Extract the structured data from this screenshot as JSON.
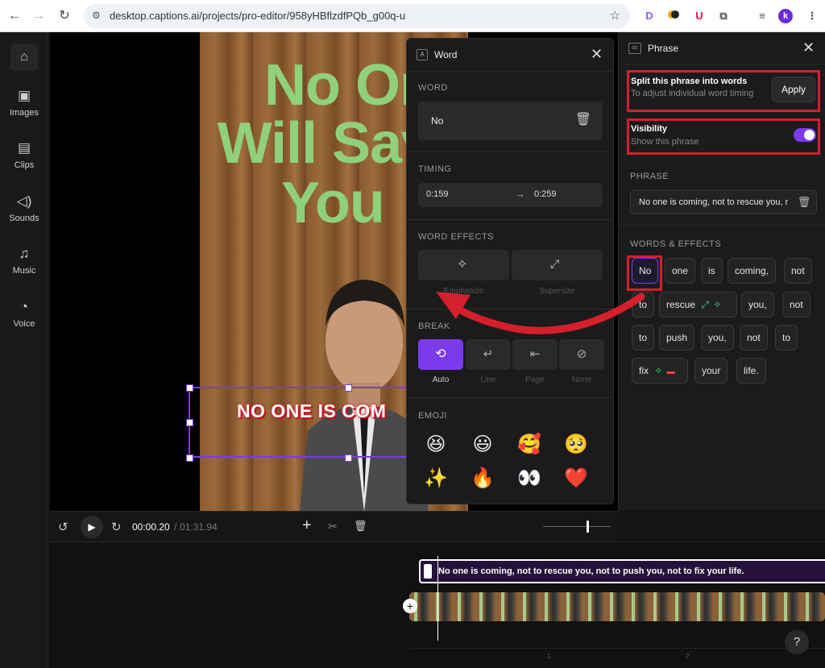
{
  "browser": {
    "url": "desktop.captions.ai/projects/pro-editor/958yHBflzdfPQb_g00q-u",
    "profile_initial": "k",
    "ext_labels": [
      "D",
      "U"
    ]
  },
  "rail": {
    "items": [
      {
        "label": "",
        "icon": "home-icon"
      },
      {
        "label": "Images",
        "icon": "image-icon"
      },
      {
        "label": "Clips",
        "icon": "film-icon"
      },
      {
        "label": "Sounds",
        "icon": "speaker-icon"
      },
      {
        "label": "Music",
        "icon": "music-icon"
      },
      {
        "label": "Voice",
        "icon": "voice-icon"
      }
    ]
  },
  "video": {
    "title_line1": "No One",
    "title_line2": "Will Save",
    "title_line3": "You",
    "caption": "NO ONE IS COM"
  },
  "word_panel": {
    "title": "Word",
    "word_label": "WORD",
    "word_value": "No",
    "timing_label": "TIMING",
    "time_start": "0:159",
    "time_end": "0:259",
    "effects_label": "WORD EFFECTS",
    "effect1": "Emphasize",
    "effect2": "Supersize",
    "breaks_label": "BREAK",
    "breaks": [
      "Auto",
      "Line",
      "Page",
      "None"
    ],
    "emoji_label": "EMOJI",
    "emojis": [
      "😆",
      "😃",
      "🥰",
      "🥺",
      "✨",
      "🔥",
      "👀",
      "❤️"
    ]
  },
  "phrase_panel": {
    "title": "Phrase",
    "split_title": "Split this phrase into words",
    "split_sub": "To adjust individual word timing",
    "apply_label": "Apply",
    "visibility_title": "Visibility",
    "visibility_sub": "Show this phrase",
    "visibility_on": true,
    "phrase_label": "PHRASE",
    "phrase_text": "No one is coming, not to rescue you, r",
    "words_label": "WORDS & EFFECTS",
    "words": [
      "No",
      "one",
      "is",
      "coming,",
      "not",
      "to",
      "rescue",
      "you,",
      "not",
      "to",
      "push",
      "you,",
      "not",
      "to",
      "fix",
      "your",
      "life."
    ]
  },
  "transport": {
    "current_time": "00:00.20",
    "separator": "/",
    "total_time": "01:31.94"
  },
  "timeline": {
    "caption_clip_text": "No one is coming, not to rescue you, not to push you, not to fix your life.",
    "ruler_marks": [
      "1",
      "2"
    ]
  },
  "colors": {
    "accent": "#7c3aed",
    "annotation_red": "#d51f2c",
    "title_green": "#8fd07a"
  }
}
